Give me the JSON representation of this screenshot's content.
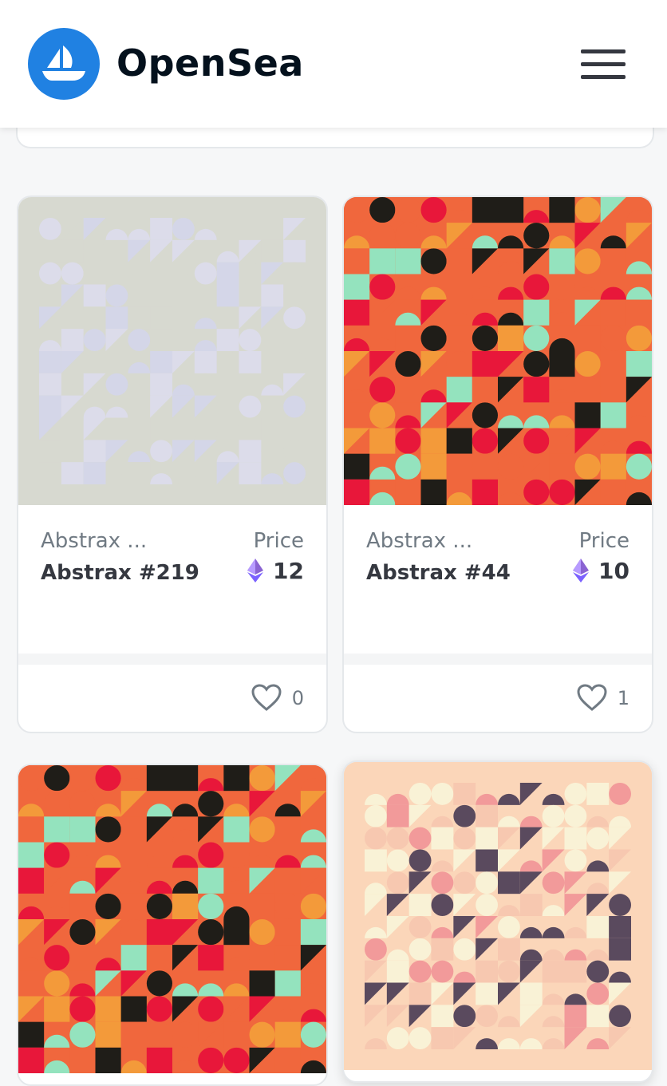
{
  "header": {
    "brand": "OpenSea",
    "logo_icon": "opensea-boat-icon",
    "menu_icon": "hamburger-menu-icon"
  },
  "cards": [
    {
      "collection": "Abstrax ...",
      "name": "Abstrax #219",
      "price_label": "Price",
      "price": "12",
      "currency_icon": "ethereum-icon",
      "likes": "0",
      "image_style": "faded-blue-grey-pattern"
    },
    {
      "collection": "Abstrax ...",
      "name": "Abstrax #44",
      "price_label": "Price",
      "price": "10",
      "currency_icon": "ethereum-icon",
      "likes": "1",
      "image_style": "orange-red-mint-pattern"
    },
    {
      "image_style": "orange-red-mint-pattern"
    },
    {
      "image_style": "peach-cream-plum-pattern"
    }
  ],
  "colors": {
    "brand_blue": "#2081e2",
    "eth_purple": "#7b61ff",
    "text_dark": "#353840",
    "text_grey": "#707a83"
  }
}
